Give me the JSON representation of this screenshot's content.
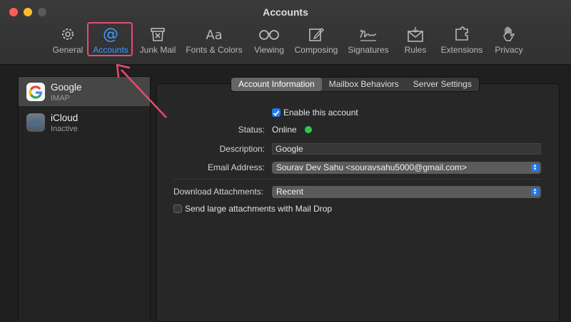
{
  "window": {
    "title": "Accounts"
  },
  "toolbar": {
    "items": [
      {
        "label": "General",
        "icon": "gear-icon"
      },
      {
        "label": "Accounts",
        "icon": "at-sign-icon",
        "active": true
      },
      {
        "label": "Junk Mail",
        "icon": "junk-mail-icon"
      },
      {
        "label": "Fonts & Colors",
        "icon": "fonts-icon"
      },
      {
        "label": "Viewing",
        "icon": "glasses-icon"
      },
      {
        "label": "Composing",
        "icon": "compose-icon"
      },
      {
        "label": "Signatures",
        "icon": "signature-icon"
      },
      {
        "label": "Rules",
        "icon": "rules-icon"
      },
      {
        "label": "Extensions",
        "icon": "puzzle-icon"
      },
      {
        "label": "Privacy",
        "icon": "hand-icon"
      }
    ]
  },
  "accounts": [
    {
      "name": "Google",
      "subtitle": "IMAP",
      "icon": "google-icon"
    },
    {
      "name": "iCloud",
      "subtitle": "Inactive",
      "icon": "icloud-icon"
    }
  ],
  "tabs": [
    "Account Information",
    "Mailbox Behaviors",
    "Server Settings"
  ],
  "form": {
    "enable_label": "Enable this account",
    "status_label": "Status:",
    "status_value": "Online",
    "description_label": "Description:",
    "description_value": "Google",
    "email_label": "Email Address:",
    "email_value": "Sourav Dev Sahu <souravsahu5000@gmail.com>",
    "download_label": "Download Attachments:",
    "download_value": "Recent",
    "maildrop_label": "Send large attachments with Mail Drop"
  },
  "colors": {
    "accent": "#3d9bff",
    "highlight": "#e84a72",
    "online": "#2fc84a"
  }
}
